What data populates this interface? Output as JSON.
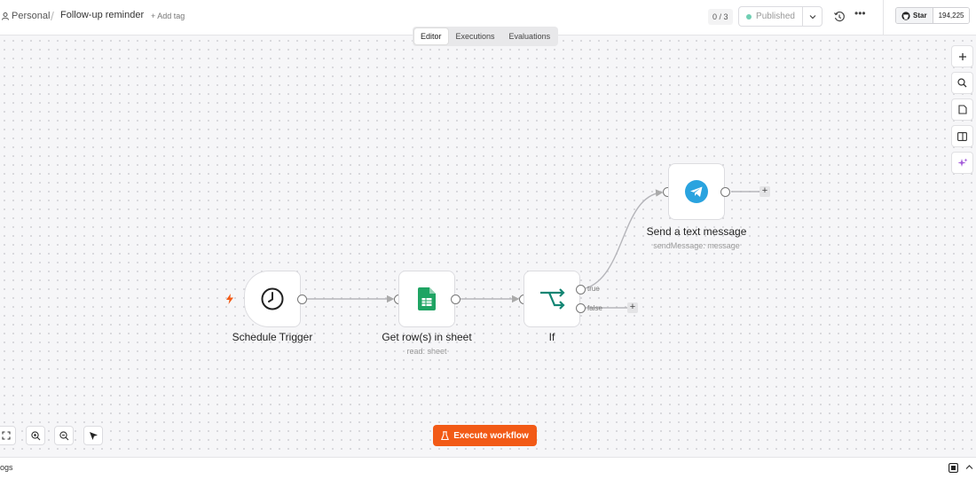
{
  "header": {
    "project": "Personal",
    "workflow_name": "Follow-up reminder",
    "add_tag": "+ Add tag",
    "counter": "0 / 3",
    "publish_label": "Published",
    "github_star": "Star",
    "github_count": "194,225"
  },
  "tabs": [
    {
      "label": "Editor",
      "active": true
    },
    {
      "label": "Executions",
      "active": false
    },
    {
      "label": "Evaluations",
      "active": false
    }
  ],
  "nodes": {
    "schedule": {
      "label": "Schedule Trigger",
      "icon": "clock-icon"
    },
    "sheet": {
      "label": "Get row(s) in sheet",
      "sub": "read: sheet",
      "icon": "google-sheets-icon"
    },
    "if": {
      "label": "If",
      "icon": "branch-icon",
      "true_label": "true",
      "false_label": "false"
    },
    "telegram": {
      "label": "Send a text message",
      "sub": "sendMessage: message",
      "icon": "telegram-icon"
    }
  },
  "execute_button": "Execute workflow",
  "logs_label": "ogs",
  "colors": {
    "accent": "#f25a16",
    "sheets_green": "#1fa463",
    "if_teal": "#138573",
    "telegram_blue": "#2aa3df",
    "published_dot": "#6fcfb3",
    "ai_purple": "#a25ad9"
  }
}
